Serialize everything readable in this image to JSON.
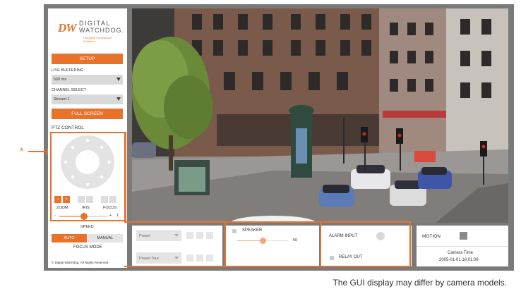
{
  "sidebar": {
    "logo_dw": "DW",
    "logo_line1": "DIGITAL",
    "logo_line2": "WATCHDOG.",
    "logo_tagline": "Complete Surveillance Solutions",
    "setup_label": "SETUP",
    "live_buffering_label": "LIVE BUFFERING",
    "live_buffering_value": "500 ms",
    "channel_select_label": "CHANNEL SELECT",
    "channel_select_value": "Stream-1",
    "fullscreen_label": "FULL SCREEN",
    "ptz_label": "PTZ CONTROL",
    "zoom_label": "ZOOM",
    "iris_label": "IRIS",
    "focus_label": "FOCUS",
    "speed_min": "1",
    "speed_label": "SPEED",
    "auto_label": "AUTO",
    "manual_label": "MANUAL",
    "focus_mode_label": "FOCUS MODE",
    "copyright": "© Digital Watchdog. All Rights Reserved."
  },
  "preset": {
    "preset_placeholder": "Preset",
    "preset_tour_placeholder": "Preset Tour"
  },
  "speaker": {
    "label": "SPEAKER",
    "value": "50",
    "level_fraction": 0.5
  },
  "alarm": {
    "alarm_input_label": "ALARM INPUT",
    "relay_out_label": "RELAY OUT"
  },
  "motion": {
    "label": "MOTION",
    "camera_time_label": "Camera Time",
    "camera_time_value": "2005-01-01 16:01:06"
  },
  "caption": "The GUI display may differ by camera models.",
  "colors": {
    "accent": "#e8722a",
    "frame": "#7a7a7a"
  }
}
